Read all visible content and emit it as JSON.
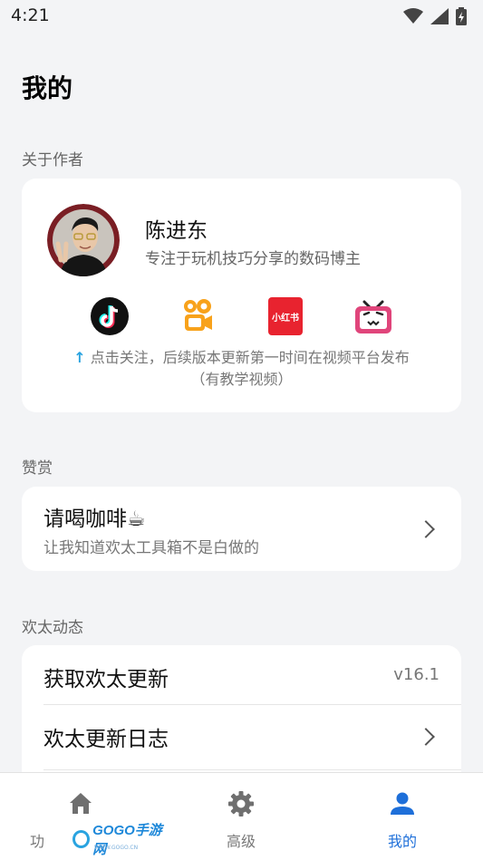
{
  "status": {
    "time": "4:21"
  },
  "page": {
    "title": "我的"
  },
  "sections": {
    "author": "关于作者",
    "tip": "赞赏",
    "dynamic": "欢太动态"
  },
  "author": {
    "name": "陈进东",
    "desc": "专注于玩机技巧分享的数码博主",
    "platforms": [
      {
        "icon": "douyin-icon"
      },
      {
        "icon": "kuaishou-icon"
      },
      {
        "icon": "xiaohongshu-icon",
        "label": "小红书"
      },
      {
        "icon": "bilibili-icon"
      }
    ],
    "follow_line1": "点击关注，后续版本更新第一时间在视频平台发布",
    "follow_line2": "（有教学视频）"
  },
  "tip": {
    "title": "请喝咖啡☕",
    "sub": "让我知道欢太工具箱不是白做的"
  },
  "dynamic": {
    "rows": [
      {
        "title": "获取欢太更新",
        "value": "v16.1"
      },
      {
        "title": "欢太更新日志"
      }
    ]
  },
  "nav": {
    "items": [
      {
        "label": "功",
        "icon": "home-icon"
      },
      {
        "label": "高级",
        "icon": "gear-icon"
      },
      {
        "label": "我的",
        "icon": "person-icon",
        "active": true
      }
    ]
  },
  "watermark": {
    "text": "GOGO手游网",
    "sub": "WWW.GOGO.CN"
  },
  "colors": {
    "accent": "#1e6fd9",
    "background": "#f3f4f6"
  }
}
